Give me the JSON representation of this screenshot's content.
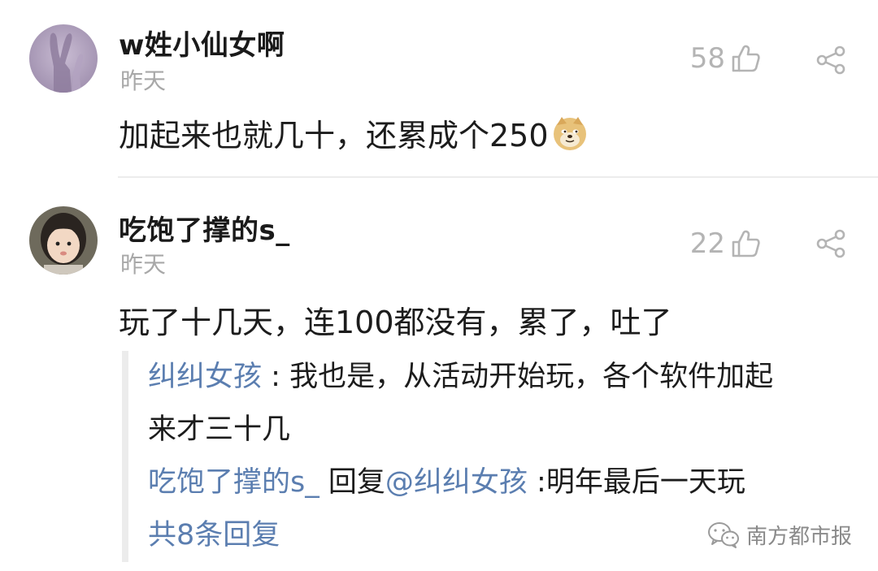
{
  "comments": [
    {
      "username": "w姓小仙女啊",
      "time": "昨天",
      "likes": "58",
      "text": "加起来也就几十，还累成个250",
      "emoji": "doge-emoji",
      "avatar": "rabbit-silhouette-avatar"
    },
    {
      "username": "吃饱了撑的s_",
      "time": "昨天",
      "likes": "22",
      "text": "玩了十几天，连100都没有，累了，吐了",
      "avatar": "child-photo-avatar",
      "replies": [
        {
          "author": "纠纠女孩",
          "separator": " : ",
          "text_line1": "我也是，从活动开始玩，各个软件加起",
          "text_line2": "来才三十几"
        },
        {
          "author": "吃饱了撑的s_",
          "reply_word": " 回复",
          "target": "@纠纠女孩",
          "separator": " :",
          "text": "明年最后一天玩"
        }
      ],
      "more_replies": "共8条回复"
    }
  ],
  "watermark": {
    "text": "南方都市报",
    "icon": "wechat-icon"
  },
  "colors": {
    "link": "#5b7eb0",
    "muted": "#a8a8a8",
    "text": "#1c1c1c"
  }
}
